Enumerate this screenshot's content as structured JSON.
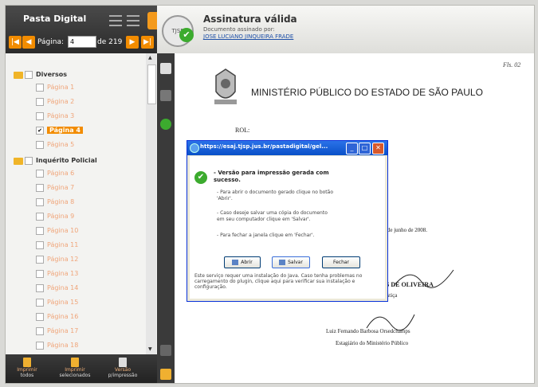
{
  "left_panel": {
    "title": "Pasta Digital",
    "page_label": "Página:",
    "page_value": "4",
    "of_label": "de 219",
    "tree": [
      {
        "type": "section",
        "label": "Diversos"
      },
      {
        "type": "page",
        "label": "Página 1",
        "checked": false
      },
      {
        "type": "page",
        "label": "Página 2",
        "checked": false
      },
      {
        "type": "page",
        "label": "Página 3",
        "checked": false
      },
      {
        "type": "page",
        "label": "Página 4",
        "checked": true
      },
      {
        "type": "page",
        "label": "Página 5",
        "checked": false
      },
      {
        "type": "section",
        "label": "Inquérito Policial"
      },
      {
        "type": "page",
        "label": "Página 6",
        "checked": false
      },
      {
        "type": "page",
        "label": "Página 7",
        "checked": false
      },
      {
        "type": "page",
        "label": "Página 8",
        "checked": false
      },
      {
        "type": "page",
        "label": "Página 9",
        "checked": false
      },
      {
        "type": "page",
        "label": "Página 10",
        "checked": false
      },
      {
        "type": "page",
        "label": "Página 11",
        "checked": false
      },
      {
        "type": "page",
        "label": "Página 12",
        "checked": false
      },
      {
        "type": "page",
        "label": "Página 13",
        "checked": false
      },
      {
        "type": "page",
        "label": "Página 14",
        "checked": false
      },
      {
        "type": "page",
        "label": "Página 15",
        "checked": false
      },
      {
        "type": "page",
        "label": "Página 16",
        "checked": false
      },
      {
        "type": "page",
        "label": "Página 17",
        "checked": false
      },
      {
        "type": "page",
        "label": "Página 18",
        "checked": false
      }
    ],
    "footer": {
      "todos_l1": "Imprimir",
      "todos_l2": "todos",
      "sel_l1": "Imprimir",
      "sel_l2": "selecionados",
      "versao_l1": "Versão",
      "versao_l2": "p/impressão"
    }
  },
  "signature": {
    "title": "Assinatura válida",
    "subtitle": "Documento assinado por:",
    "signer": "JOSE LUCIANO JINQUEIRA FRADE",
    "seal_text": "TJSP"
  },
  "document": {
    "header": "MINISTÉRIO PÚBLICO DO ESTADO DE SÃO PAULO",
    "rol": "ROL:",
    "date": "ga, 18 de junho de 2008.",
    "name1": "RCES DE OLIVEIRA",
    "role1": "de Justiça",
    "name2": "Luiz Fernando Barbosa Orsedchamps",
    "role2": "Estagiário do Ministério Público",
    "stamp": "Fls. 02"
  },
  "popup": {
    "url": "https://esaj.tjsp.jus.br/pastadigital/gel...",
    "message_l1": "- Versão para impressão gerada com",
    "message_l2": "sucesso.",
    "line1": "- Para abrir o documento gerado clique no botão",
    "line2": "'Abrir'.",
    "line3": "- Caso deseje salvar uma cópia do documento",
    "line4": "em seu computador clique em 'Salvar'.",
    "line5": "- Para fechar a janela clique em 'Fechar'.",
    "btn_open": "Abrir",
    "btn_save": "Salvar",
    "btn_close": "Fechar",
    "note": "Este serviço requer uma instalação do Java. Caso tenha problemas no carregamento do plugin, clique aqui para verificar sua instalação e configuração."
  }
}
